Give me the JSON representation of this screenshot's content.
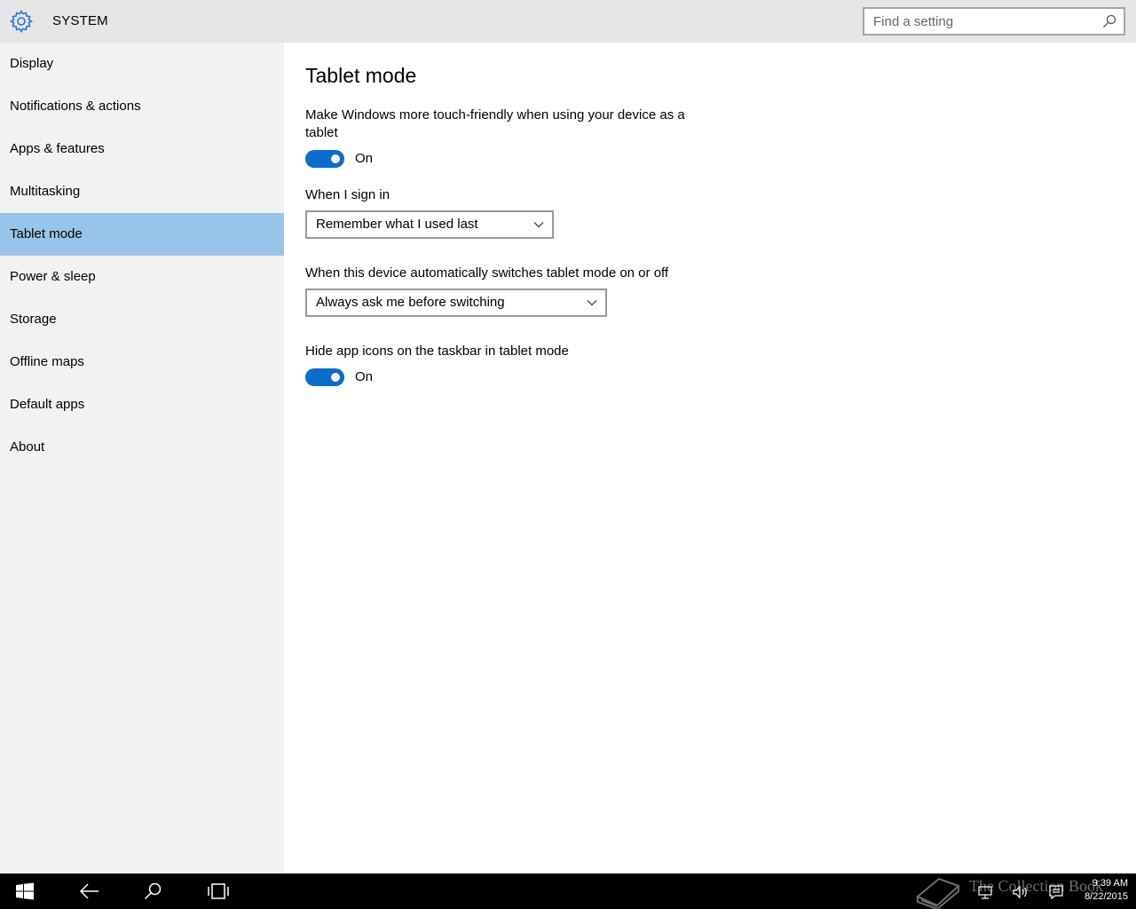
{
  "header": {
    "title": "SYSTEM",
    "search_placeholder": "Find a setting"
  },
  "sidebar": {
    "items": [
      {
        "label": "Display"
      },
      {
        "label": "Notifications & actions"
      },
      {
        "label": "Apps & features"
      },
      {
        "label": "Multitasking"
      },
      {
        "label": "Tablet mode",
        "active": true
      },
      {
        "label": "Power & sleep"
      },
      {
        "label": "Storage"
      },
      {
        "label": "Offline maps"
      },
      {
        "label": "Default apps"
      },
      {
        "label": "About"
      }
    ]
  },
  "main": {
    "title": "Tablet mode",
    "touch_friendly": {
      "label": "Make Windows more touch-friendly when using your device as a tablet",
      "state": "On"
    },
    "sign_in": {
      "label": "When I sign in",
      "selected": "Remember what I used last"
    },
    "auto_switch": {
      "label": "When this device automatically switches tablet mode on or off",
      "selected": "Always ask me before switching"
    },
    "hide_icons": {
      "label": "Hide app icons on the taskbar in tablet mode",
      "state": "On"
    }
  },
  "taskbar": {
    "watermark": "The Collection Book",
    "time": "9:39 AM",
    "date": "8/22/2015"
  },
  "colors": {
    "accent": "#0a6ccc",
    "selected_nav": "#99c4e9",
    "sidebar_bg": "#f2f2f2",
    "header_bg": "#e6e6e6",
    "gear": "#1b7ad6"
  }
}
